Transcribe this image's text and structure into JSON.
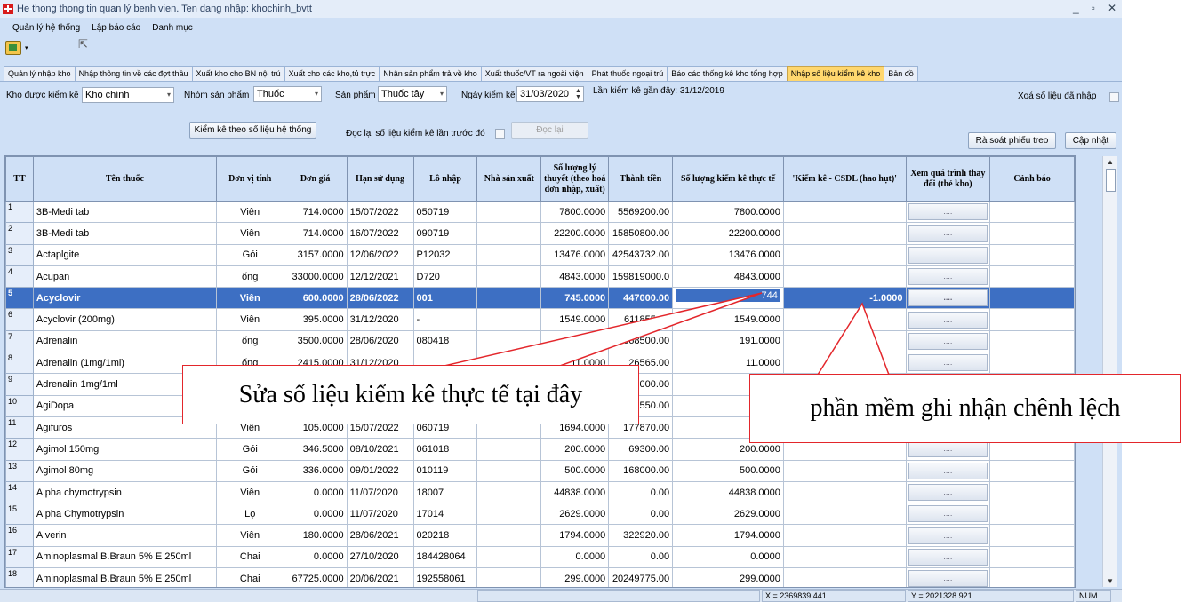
{
  "window": {
    "title": "He thong thong tin quan lý benh vien. Ten dang nhập: khochinh_bvtt"
  },
  "menu": [
    "Quản lý hệ thống",
    "Lập báo cáo",
    "Danh mục"
  ],
  "tabs": [
    "Quản lý nhập kho",
    "Nhập thông tin về các đợt thầu",
    "Xuất kho cho BN nội trú",
    "Xuất cho các kho,tủ trực",
    "Nhận sản phẩm trả về kho",
    "Xuất thuốc/VT ra ngoài viện",
    "Phát thuốc ngoại trú",
    "Báo cáo thống kê kho tổng hợp",
    "Nhập số liệu kiểm kê kho",
    "Bản đồ"
  ],
  "active_tab_index": 8,
  "filters": {
    "kho_label": "Kho được kiểm kê",
    "kho_value": "Kho chính",
    "nhom_label": "Nhóm sản phẩm",
    "nhom_value": "Thuốc",
    "sanpham_label": "Sản phẩm",
    "sanpham_value": "Thuốc tây",
    "ngay_label": "Ngày kiểm kê",
    "ngay_value": "31/03/2020",
    "lan_kiem_ke": "Lần kiểm kê gần đây: 31/12/2019",
    "xoa_label": "Xoá số liệu đã nhập",
    "doc_lai_label": "Đọc lại số liệu kiểm kê lần trước đó"
  },
  "buttons": {
    "kiem_ke": "Kiểm kê theo số liệu hệ  thống",
    "doc_lai": "Đọc lại",
    "ra_soat": "Rà soát phiếu treo",
    "cap_nhat": "Cập nhật"
  },
  "table": {
    "headers": [
      "TT",
      "Tên thuốc",
      "Đơn vị tính",
      "Đơn giá",
      "Hạn sử dụng",
      "Lô nhập",
      "Nhà sản xuất",
      "Số lượng lý thuyết (theo hoá đơn nhập, xuất)",
      "Thành tiền",
      "Số lượng kiểm kê thực tế",
      "'Kiểm kê - CSDL (hao hụt)'",
      "Xem quá trình thay đổi (thẻ kho)",
      "Cảnh báo"
    ],
    "rows": [
      {
        "tt": "1",
        "ten": "3B-Medi tab",
        "dvt": "Viên",
        "gia": "714.0000",
        "hsd": "15/07/2022",
        "lo": "050719",
        "nsx": "",
        "sllt": "7800.0000",
        "tt_tien": "5569200.00",
        "slkk": "7800.0000",
        "hh": "",
        "xem": "....",
        "cb": ""
      },
      {
        "tt": "2",
        "ten": "3B-Medi tab",
        "dvt": "Viên",
        "gia": "714.0000",
        "hsd": "16/07/2022",
        "lo": "090719",
        "nsx": "",
        "sllt": "22200.0000",
        "tt_tien": "15850800.00",
        "slkk": "22200.0000",
        "hh": "",
        "xem": "....",
        "cb": ""
      },
      {
        "tt": "3",
        "ten": "Actaplgite",
        "dvt": "Gói",
        "gia": "3157.0000",
        "hsd": "12/06/2022",
        "lo": "P12032",
        "nsx": "",
        "sllt": "13476.0000",
        "tt_tien": "42543732.00",
        "slkk": "13476.0000",
        "hh": "",
        "xem": "....",
        "cb": ""
      },
      {
        "tt": "4",
        "ten": "Acupan",
        "dvt": "ống",
        "gia": "33000.0000",
        "hsd": "12/12/2021",
        "lo": "D720",
        "nsx": "",
        "sllt": "4843.0000",
        "tt_tien": "159819000.0",
        "slkk": "4843.0000",
        "hh": "",
        "xem": "....",
        "cb": ""
      },
      {
        "tt": "5",
        "ten": "Acyclovir",
        "dvt": "Viên",
        "gia": "600.0000",
        "hsd": "28/06/2022",
        "lo": "001",
        "nsx": "",
        "sllt": "745.0000",
        "tt_tien": "447000.00",
        "slkk": "744",
        "hh": "-1.0000",
        "xem": "....",
        "cb": ""
      },
      {
        "tt": "6",
        "ten": "Acyclovir (200mg)",
        "dvt": "Viên",
        "gia": "395.0000",
        "hsd": "31/12/2020",
        "lo": "-",
        "nsx": "",
        "sllt": "1549.0000",
        "tt_tien": "611855.00",
        "slkk": "1549.0000",
        "hh": "",
        "xem": "....",
        "cb": ""
      },
      {
        "tt": "7",
        "ten": "Adrenalin",
        "dvt": "ống",
        "gia": "3500.0000",
        "hsd": "28/06/2020",
        "lo": "080418",
        "nsx": "",
        "sllt": "191.0000",
        "tt_tien": "668500.00",
        "slkk": "191.0000",
        "hh": "",
        "xem": "....",
        "cb": ""
      },
      {
        "tt": "8",
        "ten": "Adrenalin (1mg/1ml)",
        "dvt": "ống",
        "gia": "2415.0000",
        "hsd": "31/12/2020",
        "lo": "",
        "nsx": "",
        "sllt": "11.0000",
        "tt_tien": "26565.00",
        "slkk": "11.0000",
        "hh": "",
        "xem": "....",
        "cb": ""
      },
      {
        "tt": "9",
        "ten": "Adrenalin 1mg/1ml",
        "dvt": "",
        "gia": "",
        "hsd": "",
        "lo": "",
        "nsx": "",
        "sllt": "",
        "tt_tien": "000.00",
        "slkk": "20",
        "hh": "",
        "xem": "....",
        "cb": ""
      },
      {
        "tt": "10",
        "ten": "AgiDopa",
        "dvt": "",
        "gia": "",
        "hsd": "",
        "lo": "",
        "nsx": "",
        "sllt": "",
        "tt_tien": "550.00",
        "slkk": "70",
        "hh": "",
        "xem": "....",
        "cb": ""
      },
      {
        "tt": "11",
        "ten": "Agifuros",
        "dvt": "Viên",
        "gia": "105.0000",
        "hsd": "15/07/2022",
        "lo": "060719",
        "nsx": "",
        "sllt": "1694.0000",
        "tt_tien": "177870.00",
        "slkk": "169",
        "hh": "",
        "xem": "....",
        "cb": ""
      },
      {
        "tt": "12",
        "ten": "Agimol 150mg",
        "dvt": "Gói",
        "gia": "346.5000",
        "hsd": "08/10/2021",
        "lo": "061018",
        "nsx": "",
        "sllt": "200.0000",
        "tt_tien": "69300.00",
        "slkk": "200.0000",
        "hh": "",
        "xem": "....",
        "cb": ""
      },
      {
        "tt": "13",
        "ten": "Agimol 80mg",
        "dvt": "Gói",
        "gia": "336.0000",
        "hsd": "09/01/2022",
        "lo": "010119",
        "nsx": "",
        "sllt": "500.0000",
        "tt_tien": "168000.00",
        "slkk": "500.0000",
        "hh": "",
        "xem": "....",
        "cb": ""
      },
      {
        "tt": "14",
        "ten": "Alpha chymotrypsin",
        "dvt": "Viên",
        "gia": "0.0000",
        "hsd": "11/07/2020",
        "lo": "18007",
        "nsx": "",
        "sllt": "44838.0000",
        "tt_tien": "0.00",
        "slkk": "44838.0000",
        "hh": "",
        "xem": "....",
        "cb": ""
      },
      {
        "tt": "15",
        "ten": "Alpha Chymotrypsin",
        "dvt": "Lọ",
        "gia": "0.0000",
        "hsd": "11/07/2020",
        "lo": "17014",
        "nsx": "",
        "sllt": "2629.0000",
        "tt_tien": "0.00",
        "slkk": "2629.0000",
        "hh": "",
        "xem": "....",
        "cb": ""
      },
      {
        "tt": "16",
        "ten": "Alverin",
        "dvt": "Viên",
        "gia": "180.0000",
        "hsd": "28/06/2021",
        "lo": "020218",
        "nsx": "",
        "sllt": "1794.0000",
        "tt_tien": "322920.00",
        "slkk": "1794.0000",
        "hh": "",
        "xem": "....",
        "cb": ""
      },
      {
        "tt": "17",
        "ten": "Aminoplasmal B.Braun 5% E 250ml",
        "dvt": "Chai",
        "gia": "0.0000",
        "hsd": "27/10/2020",
        "lo": "184428064",
        "nsx": "",
        "sllt": "0.0000",
        "tt_tien": "0.00",
        "slkk": "0.0000",
        "hh": "",
        "xem": "....",
        "cb": ""
      },
      {
        "tt": "18",
        "ten": "Aminoplasmal B.Braun 5% E 250ml",
        "dvt": "Chai",
        "gia": "67725.0000",
        "hsd": "20/06/2021",
        "lo": "192558061",
        "nsx": "",
        "sllt": "299.0000",
        "tt_tien": "20249775.00",
        "slkk": "299.0000",
        "hh": "",
        "xem": "....",
        "cb": ""
      }
    ],
    "selected_row": 4
  },
  "status": {
    "x": "X = 2369839.441",
    "y": "Y = 2021328.921",
    "num": "NUM"
  },
  "callouts": {
    "left": "Sửa số liệu kiểm kê thực tế tại đây",
    "right": "phần mềm ghi nhận chênh lệch"
  },
  "colors": {
    "selection": "#3d6fc3",
    "active_tab": "#ffd76e",
    "callout_border": "#e3262b"
  }
}
